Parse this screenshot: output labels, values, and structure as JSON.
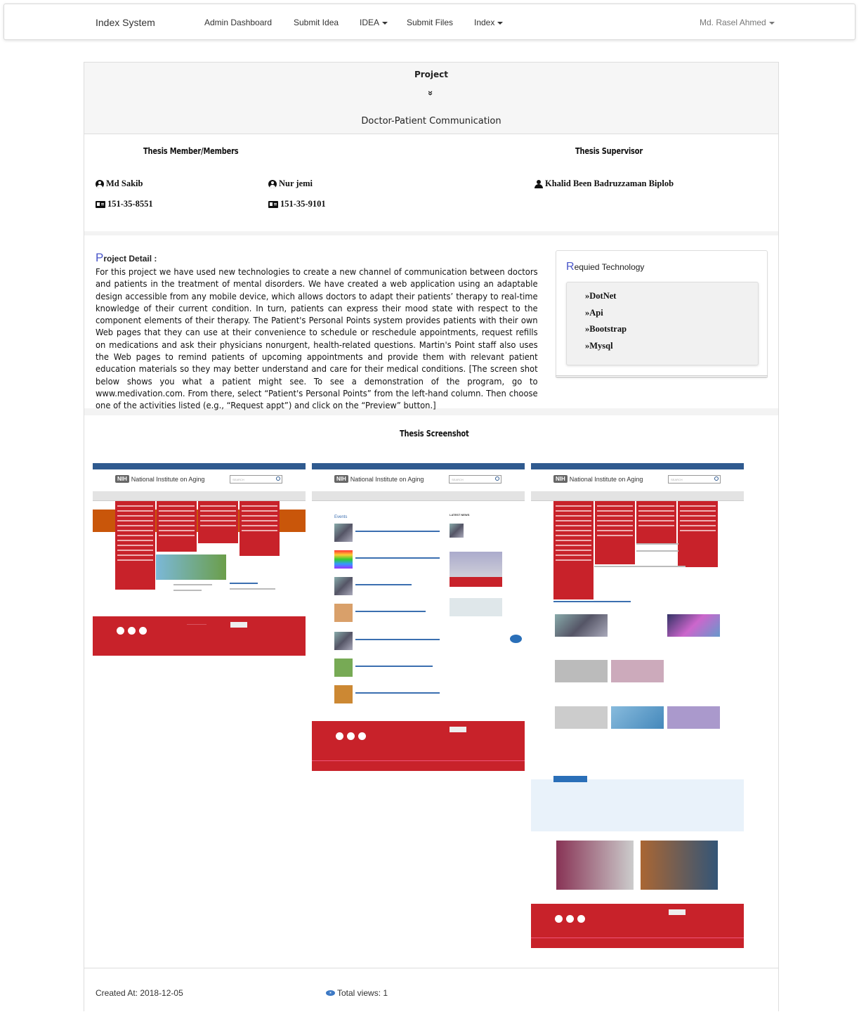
{
  "navbar": {
    "brand": "Index System",
    "items": [
      {
        "label": "Admin Dashboard"
      },
      {
        "label": "Submit Idea"
      },
      {
        "label": "IDEA"
      },
      {
        "label": "Submit Files"
      },
      {
        "label": "Index"
      }
    ],
    "user": "Md. Rasel Ahmed"
  },
  "header": {
    "label": "Project",
    "arrow": "»",
    "title": "Doctor-Patient Communication"
  },
  "members": {
    "heading": "Thesis Member/Members",
    "list": [
      {
        "name": "Md Sakib",
        "id": "151-35-8551"
      },
      {
        "name": "Nur jemi",
        "id": "151-35-9101"
      }
    ]
  },
  "supervisor": {
    "heading": "Thesis Supervisor",
    "name": "Khalid Been Badruzzaman Biplob"
  },
  "detail": {
    "heading_first": "P",
    "heading_rest": "roject Detail :",
    "text": "For this project we have used new technologies to create a new channel of communication between doctors and patients in the treatment of mental disorders. We have created a web application using an adaptable design accessible from any mobile device, which allows doctors to adapt their patients’ therapy to real-time knowledge of their current condition. In turn, patients can express their mood state with respect to the component elements of their therapy. The Patient's Personal Points system provides patients with their own Web pages that they can use at their convenience to schedule or reschedule appointments, request refills on medications and ask their physicians nonurgent, health-related questions. Martin's Point staff also uses the Web pages to remind patients of upcoming appointments and provide them with relevant patient education materials so they may better understand and care for their medical conditions. [The screen shot below shows you what a patient might see. To see a demonstration of the program, go to www.medivation.com. From there, select “Patient's Personal Points” from the left-hand column. Then choose one of the activities listed (e.g., “Request appt”) and click on the “Preview” button.]"
  },
  "technology": {
    "heading_first": "R",
    "heading_rest": "equied Technology",
    "items": [
      "DotNet",
      "Api",
      "Bootstrap",
      "Mysql"
    ]
  },
  "screenshots": {
    "heading": "Thesis Screenshot",
    "site_title": "National Institute on Aging",
    "site_logo": "NIH",
    "search_placeholder": "SEARCH",
    "events_heading": "Events",
    "latest_news": "LATEST NEWS"
  },
  "footer": {
    "created": "Created At: 2018-12-05",
    "views": "Total views: 1"
  },
  "colors": {
    "accent": "#4a56c9",
    "nih_red": "#c8222a",
    "nih_blue": "#2f5a8f"
  }
}
